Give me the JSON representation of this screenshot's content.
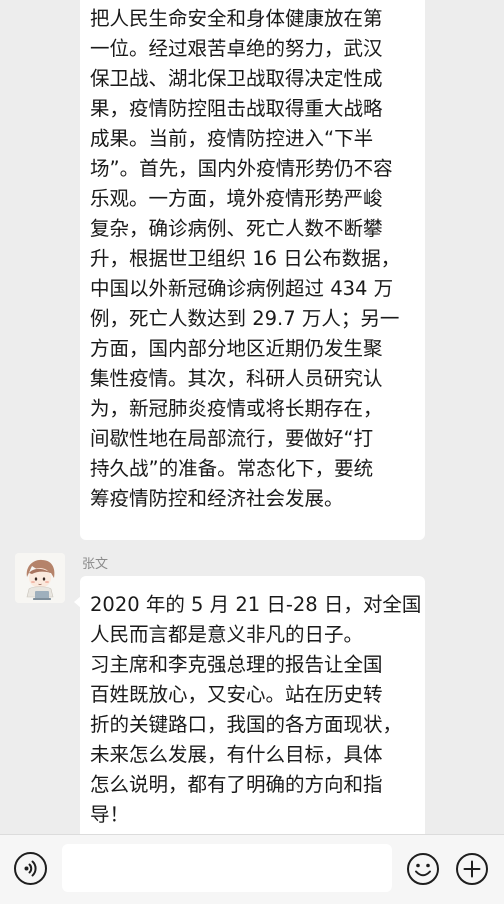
{
  "messages": [
    {
      "sender": "",
      "lines": [
        "把人民生命安全和身体健康放在第",
        "一位。经过艰苦卓绝的努力，武汉",
        "保卫战、湖北保卫战取得决定性成",
        "果，疫情防控阻击战取得重大战略",
        "成果。当前，疫情防控进入“下半",
        "场”。首先，国内外疫情形势仍不容",
        "乐观。一方面，境外疫情形势严峻",
        "复杂，确诊病例、死亡人数不断攀",
        "升，根据世卫组织 16 日公布数据，",
        "中国以外新冠确诊病例超过 434 万",
        "例，死亡人数达到 29.7 万人；另一",
        "方面，国内部分地区近期仍发生聚",
        "集性疫情。其次，科研人员研究认",
        "为，新冠肺炎疫情或将长期存在，",
        "间歇性地在局部流行，要做好“打",
        "持久战”的准备。常态化下，要统",
        "筹疫情防控和经济社会发展。"
      ]
    },
    {
      "sender": "张文",
      "lines": [
        "2020 年的 5 月 21 日-28 日，对全国",
        "人民而言都是意义非凡的日子。",
        "习主席和李克强总理的报告让全国",
        "百姓既放心，又安心。站在历史转",
        "折的关键路口，我国的各方面现状，",
        "未来怎么发展，有什么目标，具体",
        "怎么说明，都有了明确的方向和指",
        "导！"
      ]
    }
  ],
  "input_bar": {
    "voice_icon": "voice-icon",
    "emoji_icon": "emoji-icon",
    "plus_icon": "plus-icon",
    "input_value": ""
  },
  "colors": {
    "background": "#ededed",
    "bubble": "#ffffff",
    "text": "#1a1a1a",
    "sender_name": "#8a8a8a",
    "input_bar": "#f6f6f6"
  }
}
